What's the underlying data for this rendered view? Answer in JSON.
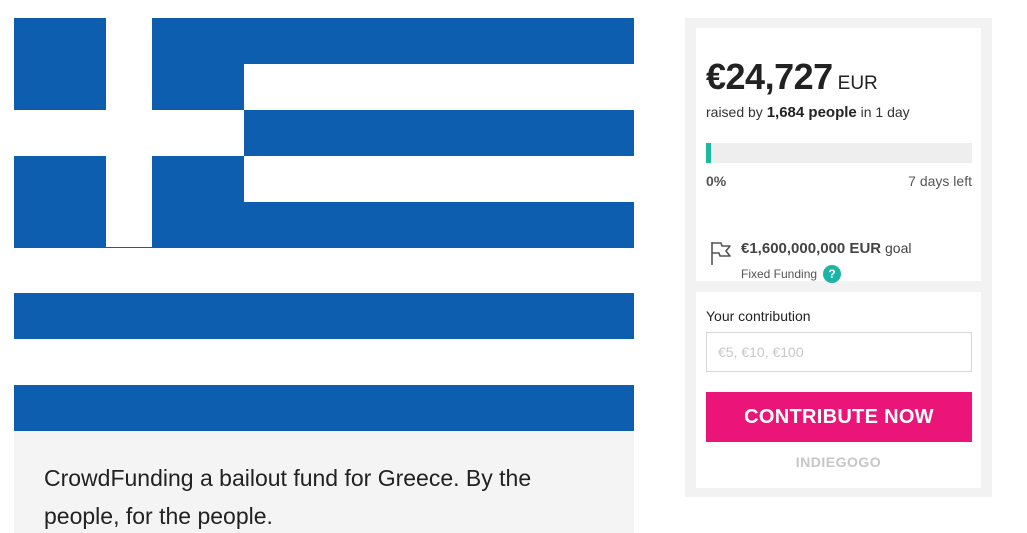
{
  "campaign": {
    "description": "CrowdFunding a bailout fund for Greece. By the people, for the people."
  },
  "funding": {
    "amount": "€24,727",
    "currency": "EUR",
    "raised_prefix": "raised by",
    "backers": "1,684 people",
    "raised_suffix": "in 1 day",
    "progress_percent": 0.5,
    "percent_label": "0%",
    "days_left": "7 days left",
    "goal_amount": "€1,600,000,000 EUR",
    "goal_suffix": "goal",
    "funding_type": "Fixed Funding",
    "help_symbol": "?",
    "colors": {
      "progress": "#1abc9c",
      "help": "#1ab5a6"
    }
  },
  "contribution": {
    "label": "Your contribution",
    "placeholder": "€5, €10, €100",
    "button_label": "CONTRIBUTE NOW",
    "button_color": "#eb1478",
    "brand": "INDIEGOGO"
  },
  "flag": {
    "blue": "#0d5eaf",
    "white": "#ffffff"
  },
  "icons": {
    "goal": "flag-icon",
    "help": "help-icon"
  }
}
